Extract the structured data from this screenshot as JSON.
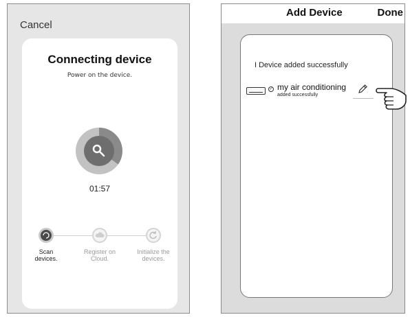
{
  "left_screen": {
    "cancel_label": "Cancel",
    "title": "Connecting device",
    "subtitle": "Power on the device.",
    "timer": "01:57",
    "steps": [
      {
        "label": "Scan\ndevices.",
        "state": "active"
      },
      {
        "label": "Register on\nCloud.",
        "state": "pending"
      },
      {
        "label": "Initialize the\ndevices.",
        "state": "pending"
      }
    ],
    "progress_fraction": 0.35
  },
  "right_screen": {
    "title": "Add Device",
    "done_label": "Done",
    "added_message": "I Device added successfully",
    "device": {
      "name": "my air conditioning",
      "status": "added successfully",
      "icon": "air-conditioner-icon"
    }
  },
  "colors": {
    "screen_bg_left": "#e6e6e6",
    "screen_bg_right": "#dcdcdc",
    "card_bg": "#ffffff",
    "active_step": "#4a4a4a",
    "inactive_text": "#9a9a9a"
  }
}
